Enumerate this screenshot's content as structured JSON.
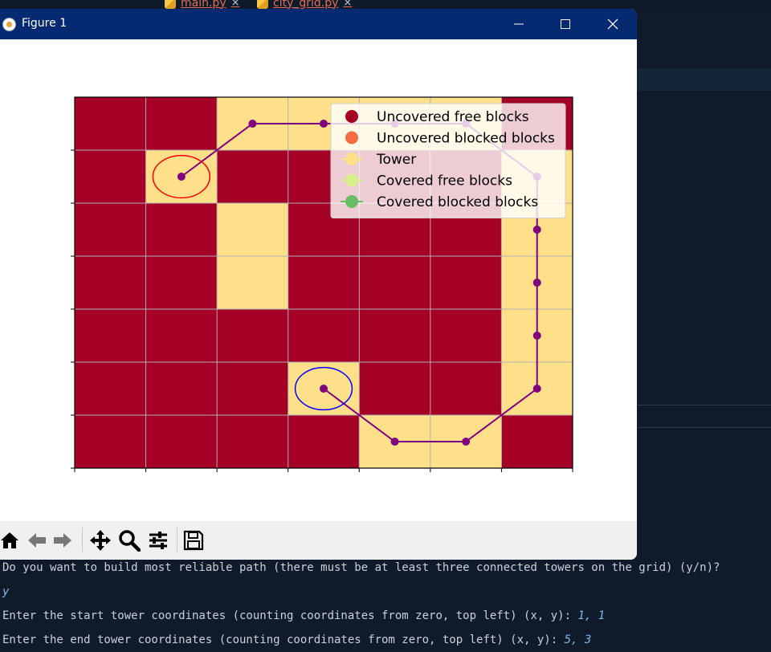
{
  "ide": {
    "tabs": [
      {
        "label": "main.py",
        "close": "×"
      },
      {
        "label": "city_grid.py",
        "close": "×"
      }
    ]
  },
  "figure": {
    "title": "Figure 1",
    "grid": {
      "cols": 7,
      "rows": 7,
      "cells": [
        [
          "free",
          "free",
          "tower",
          "tower",
          "tower",
          "tower",
          "free"
        ],
        [
          "free",
          "tower",
          "free",
          "free",
          "free",
          "free",
          "tower"
        ],
        [
          "free",
          "free",
          "tower",
          "free",
          "free",
          "free",
          "tower"
        ],
        [
          "free",
          "free",
          "tower",
          "free",
          "free",
          "free",
          "tower"
        ],
        [
          "free",
          "free",
          "free",
          "free",
          "free",
          "free",
          "tower"
        ],
        [
          "free",
          "free",
          "free",
          "tower",
          "free",
          "free",
          "tower"
        ],
        [
          "free",
          "free",
          "free",
          "free",
          "tower",
          "tower",
          "free"
        ]
      ],
      "path": [
        [
          1,
          1
        ],
        [
          2,
          0
        ],
        [
          3,
          0
        ],
        [
          4,
          0
        ],
        [
          5,
          0
        ],
        [
          6,
          1
        ],
        [
          6,
          2
        ],
        [
          6,
          3
        ],
        [
          6,
          4
        ],
        [
          6,
          5
        ],
        [
          5,
          6
        ],
        [
          4,
          6
        ],
        [
          3,
          5
        ]
      ],
      "start": [
        1,
        1
      ],
      "end": [
        3,
        5
      ]
    },
    "colors": {
      "free": "#a50026",
      "blocked": "#f46d43",
      "tower": "#fee08b",
      "covered_free": "#d9ef8b",
      "covered_blocked": "#66bd63",
      "path": "#800080",
      "start_ring": "#ff0000",
      "end_ring": "#0000ff"
    },
    "legend": [
      {
        "label": "Uncovered free blocks",
        "color": "#a50026",
        "line": false
      },
      {
        "label": "Uncovered blocked blocks",
        "color": "#f46d43",
        "line": false
      },
      {
        "label": "Tower",
        "color": "#fee08b",
        "line": true
      },
      {
        "label": "Covered free blocks",
        "color": "#d9ef8b",
        "line": true
      },
      {
        "label": "Covered blocked blocks",
        "color": "#66bd63",
        "line": true
      }
    ],
    "toolbar": [
      "home-icon",
      "back-icon",
      "forward-icon",
      "pan-icon",
      "zoom-icon",
      "configure-icon",
      "save-icon"
    ]
  },
  "terminal": {
    "lines": [
      {
        "text": "Do you want to build most reliable path (there must be at least three connected towers on the grid) (y/n)?",
        "input": ""
      },
      {
        "text": "",
        "input": "y"
      },
      {
        "text": "Enter the start tower coordinates (counting coordinates from zero, top left) (x, y): ",
        "input": "1, 1"
      },
      {
        "text": "Enter the end tower coordinates (counting coordinates from zero, top left) (x, y): ",
        "input": "5, 3"
      }
    ]
  }
}
